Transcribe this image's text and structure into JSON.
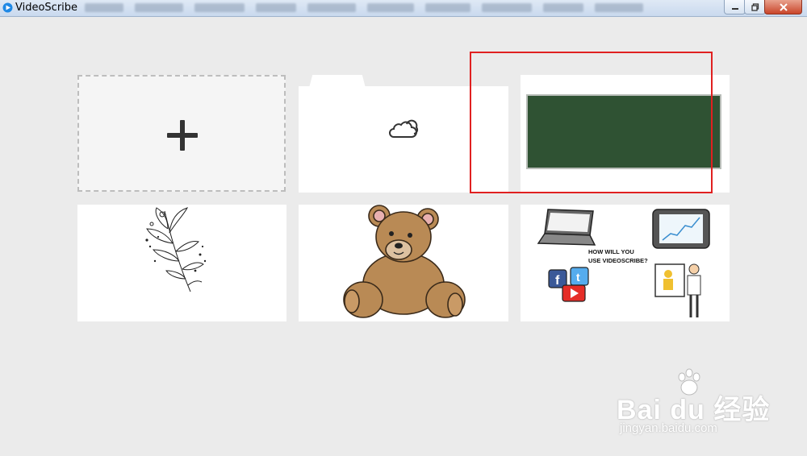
{
  "window": {
    "title": "VideoScribe",
    "buttons": [
      "minimize",
      "maximize",
      "close"
    ]
  },
  "cards": {
    "new_scribe": {
      "icon": "plus-icon"
    },
    "cloud_folder": {
      "icon": "cloud-icon"
    },
    "chalkboard_scribe": {
      "highlighted": true,
      "board_color": "#2f5233"
    },
    "flower_scribe": {
      "icon": "flower-illustration"
    },
    "bear_scribe": {
      "icon": "teddy-bear-illustration"
    },
    "promo_scribe": {
      "text_line1": "HOW WILL YOU",
      "text_line2": "USE VIDEOSCRIBE?"
    }
  },
  "watermark": {
    "brand": "Bai du 经验",
    "url": "jingyan.baidu.com"
  },
  "colors": {
    "background": "#ebebeb",
    "highlight": "#e02020",
    "chalkboard": "#2f5233"
  }
}
